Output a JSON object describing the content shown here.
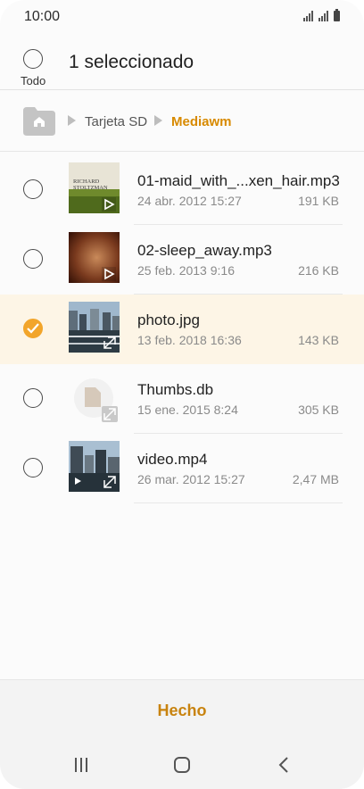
{
  "status_bar": {
    "time": "10:00"
  },
  "header": {
    "select_all_label": "Todo",
    "title": "1 seleccionado"
  },
  "breadcrumb": {
    "items": [
      "Tarjeta SD",
      "Mediawm"
    ]
  },
  "files": [
    {
      "name": "01-maid_with_...xen_hair.mp3",
      "date": "24 abr. 2012 15:27",
      "size": "191 KB",
      "selected": false,
      "type": "audio"
    },
    {
      "name": "02-sleep_away.mp3",
      "date": "25 feb. 2013 9:16",
      "size": "216 KB",
      "selected": false,
      "type": "audio"
    },
    {
      "name": "photo.jpg",
      "date": "13 feb. 2018 16:36",
      "size": "143 KB",
      "selected": true,
      "type": "image"
    },
    {
      "name": "Thumbs.db",
      "date": "15 ene. 2015 8:24",
      "size": "305 KB",
      "selected": false,
      "type": "file"
    },
    {
      "name": "video.mp4",
      "date": "26 mar. 2012 15:27",
      "size": "2,47 MB",
      "selected": false,
      "type": "video"
    }
  ],
  "thumbs": {
    "album_text_line1": "RICHARD",
    "album_text_line2": "STOLTZMAN"
  },
  "footer": {
    "done_label": "Hecho"
  },
  "colors": {
    "accent": "#f2a52b",
    "accent_text": "#c8830f",
    "selected_row_bg": "#fdf5e6"
  }
}
